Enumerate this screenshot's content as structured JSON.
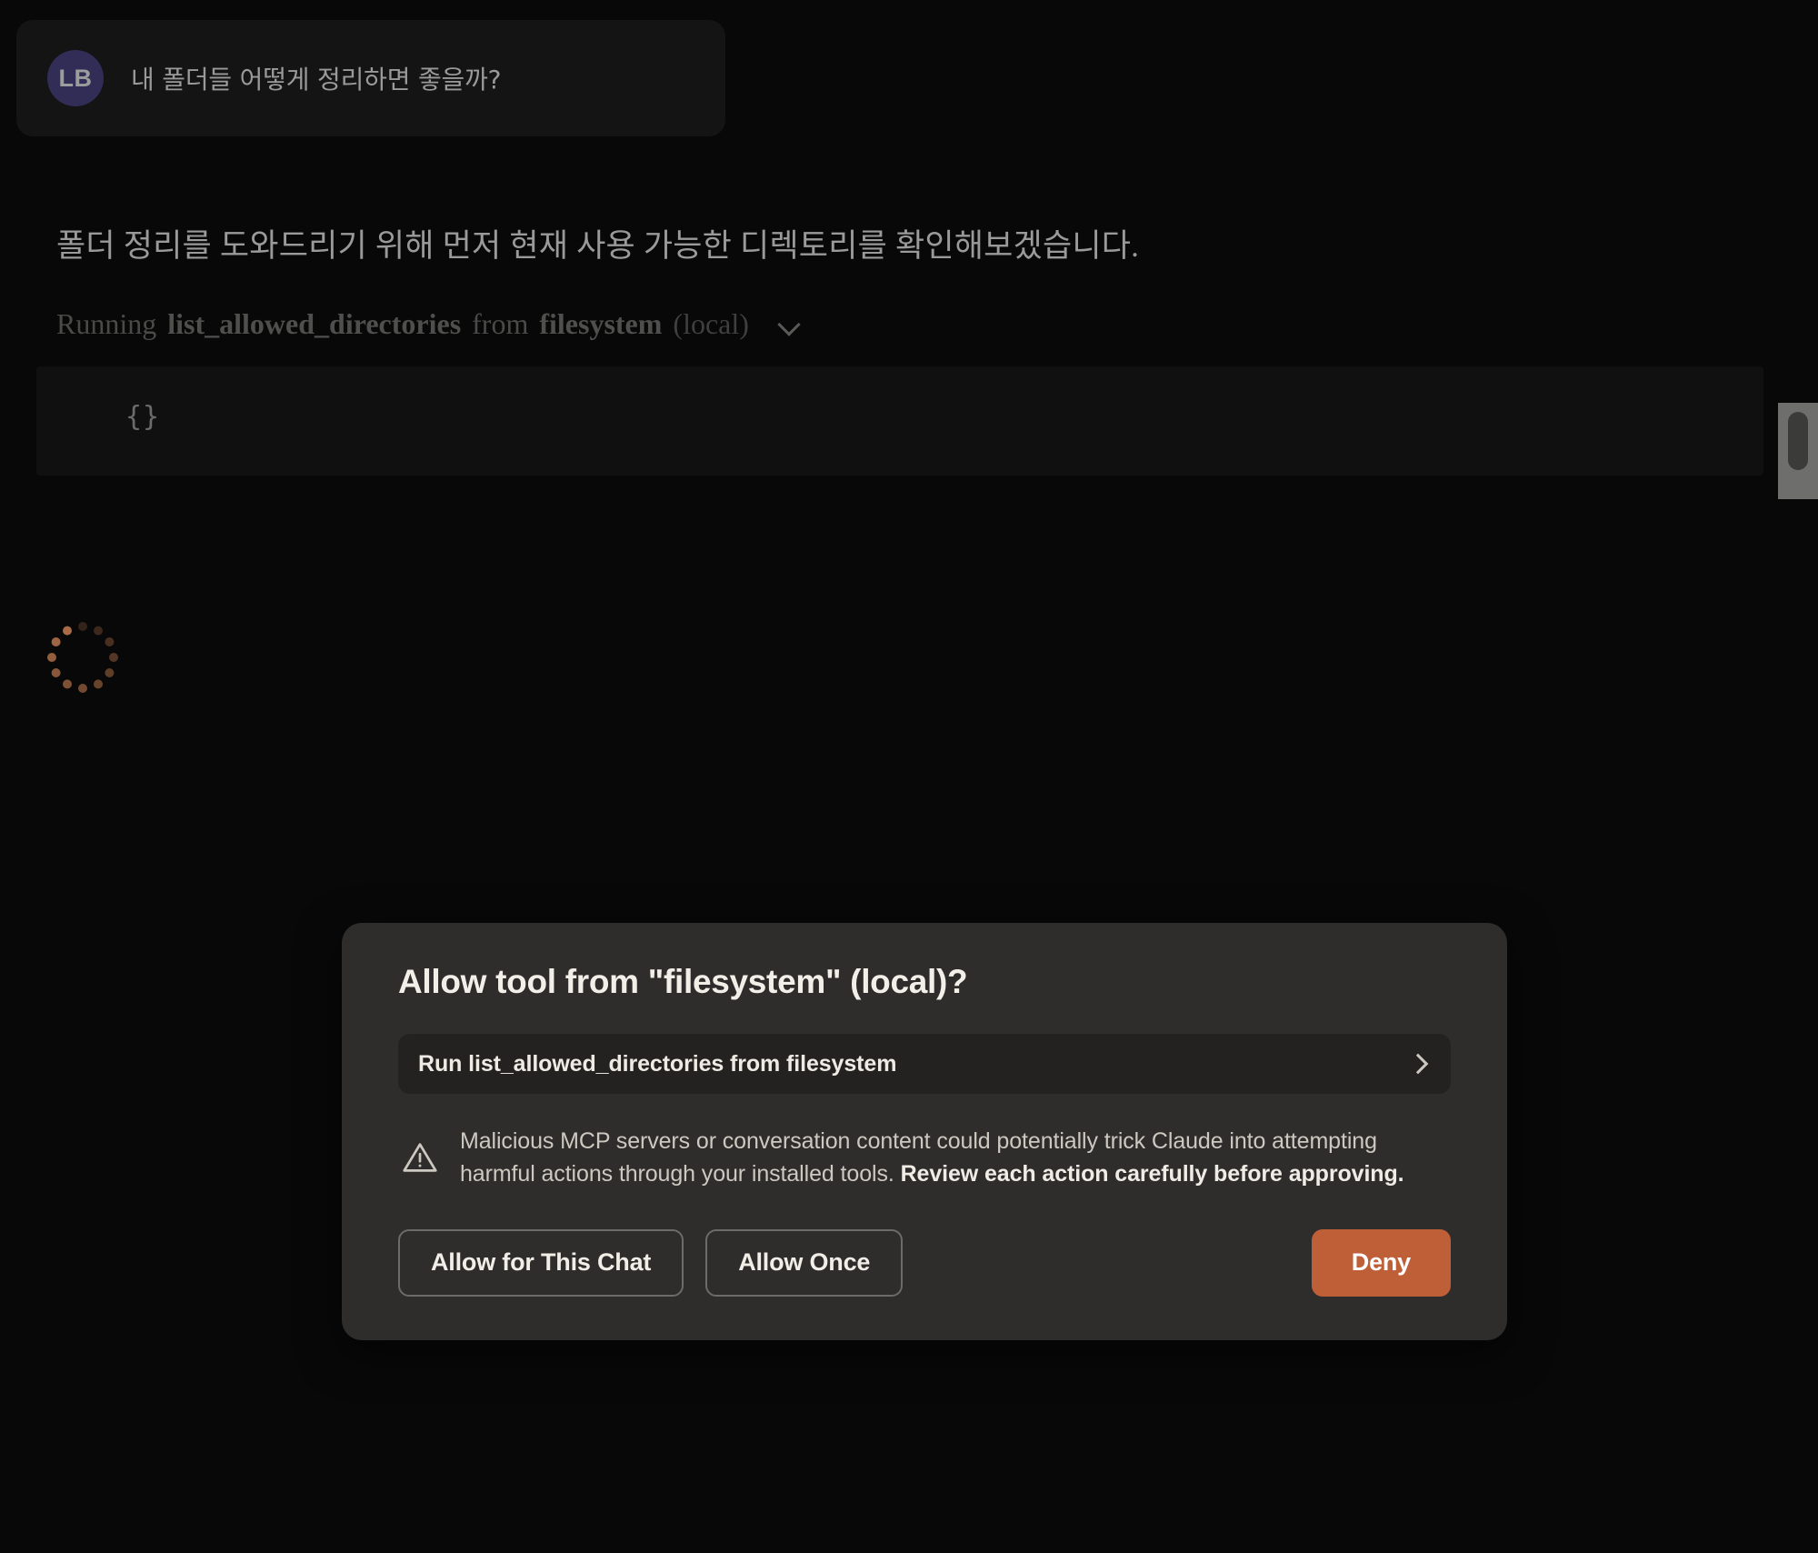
{
  "conversation": {
    "user_message": {
      "avatar_initials": "LB",
      "avatar_color": "#312d56",
      "text": "내 폴더들 어떻게 정리하면 좋을까?"
    },
    "assistant_message": {
      "paragraph": "폴더 정리를 도와드리기 위해 먼저 현재 사용 가능한 디렉토리를 확인해보겠습니다.",
      "tool_call": {
        "running_label": "Running",
        "tool_name": "list_allowed_directories",
        "from_label": "from",
        "server_name": "filesystem",
        "scope": "(local)",
        "arguments": "{}"
      }
    },
    "status": {
      "spinner_color": "#b3724a",
      "spinner_dots": 12
    }
  },
  "dialog": {
    "title": "Allow tool from \"filesystem\" (local)?",
    "tool_request": "Run list_allowed_directories from filesystem",
    "warning": {
      "text_normal_1": "Malicious MCP servers or conversation content could potentially trick Claude into attempting harmful actions through your installed tools. ",
      "text_bold": "Review each action carefully before approving."
    },
    "buttons": {
      "allow_chat": "Allow for This Chat",
      "allow_once": "Allow Once",
      "deny": "Deny",
      "deny_color": "#bf5f38"
    }
  }
}
